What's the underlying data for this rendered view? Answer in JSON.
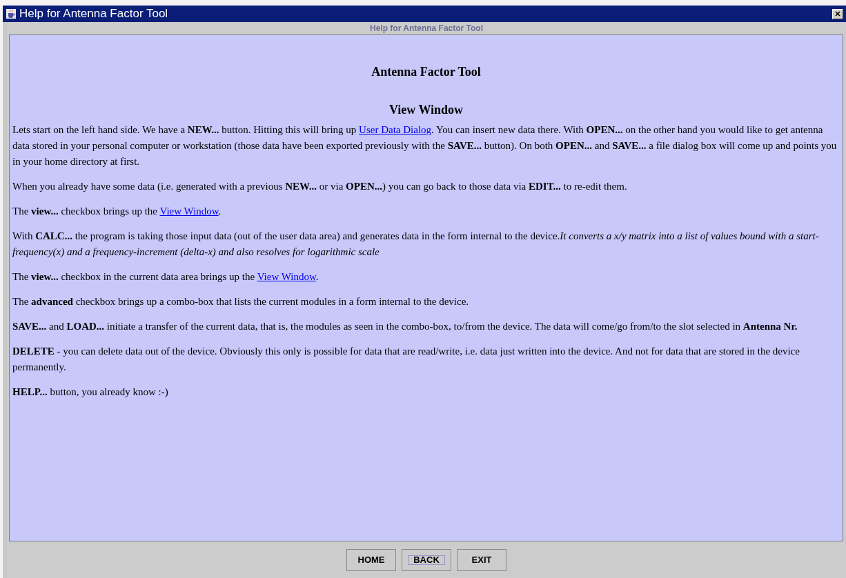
{
  "window": {
    "title": "Help for Antenna Factor Tool"
  },
  "subtitle": "Help for Antenna Factor Tool",
  "content": {
    "heading": "Antenna Factor Tool",
    "subheading": "View Window",
    "paragraphs": [
      [
        {
          "kind": "text",
          "text": "Lets start on the left hand side. We have a **NEW...** button. Hitting this will bring up "
        },
        {
          "kind": "link",
          "text": "User Data Dialog"
        },
        {
          "kind": "text",
          "text": ". You can insert new data there. With **OPEN...** on the other hand you would like to get antenna data stored in your personal computer or workstation (those data have been exported previously with the **SAVE...** button). On both **OPEN...** and **SAVE...** a file dialog box will come up and points you in your home directory at first."
        }
      ],
      [
        {
          "kind": "text",
          "text": "When you already have some data (i.e. generated with a previous **NEW...** or via **OPEN...**) you can go back to those data via **EDIT...** to re-edit them."
        }
      ],
      [
        {
          "kind": "text",
          "text": "The **view...** checkbox brings up the "
        },
        {
          "kind": "link",
          "text": "View Window"
        },
        {
          "kind": "text",
          "text": "."
        }
      ],
      [
        {
          "kind": "text",
          "text": "With **CALC...** the program is taking those input data (out of the user data area) and generates data in the form internal to the device.*It converts a x/y matrix into a list of values bound with a start-frequency(x) and a frequency-increment (delta-x) and also resolves for logarithmic scale*"
        }
      ],
      [
        {
          "kind": "text",
          "text": "The **view...** checkbox in the current data area brings up the "
        },
        {
          "kind": "link",
          "text": "View Window"
        },
        {
          "kind": "text",
          "text": "."
        }
      ],
      [
        {
          "kind": "text",
          "text": "The **advanced** checkbox brings up a combo-box that lists the current modules in a form internal to the device."
        }
      ],
      [
        {
          "kind": "text",
          "text": "**SAVE...** and **LOAD...** initiate a transfer of the current data, that is, the modules as seen in the combo-box, to/from the device. The data will come/go from/to the slot selected in **Antenna Nr.**"
        }
      ],
      [
        {
          "kind": "text",
          "text": "**DELETE** - you can delete data out of the device. Obviously this only is possible for data that are read/write, i.e. data just written into the device. And not for data that are stored in the device permanently."
        }
      ],
      [
        {
          "kind": "text",
          "text": "**HELP...** button, you already know :-)"
        }
      ]
    ]
  },
  "buttons": [
    {
      "label": "HOME",
      "focused": false
    },
    {
      "label": "BACK",
      "focused": true
    },
    {
      "label": "EXIT",
      "focused": false
    }
  ]
}
